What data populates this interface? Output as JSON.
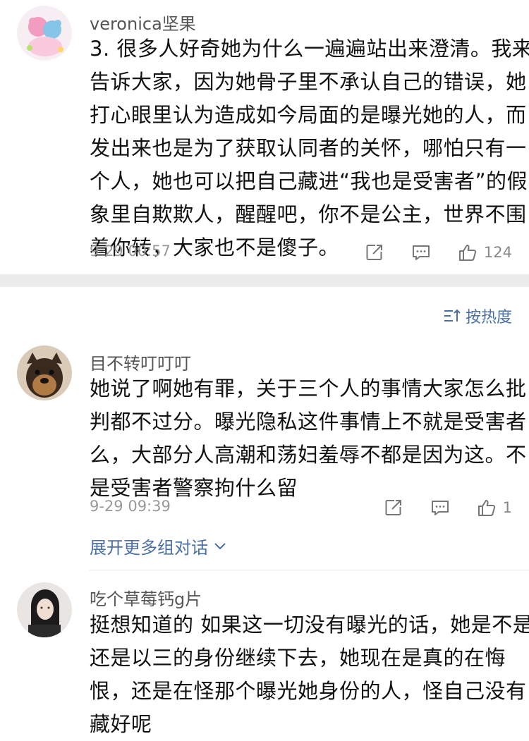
{
  "comments": [
    {
      "username": "veronica坚果",
      "lines": [
        "3. 很多人好奇她为什么一遍遍站出来澄清。我来",
        "告诉大家，因为她骨子里不承认自己的错误，她",
        "打心眼里认为造成如今局面的是曝光她的人，而",
        "发出来也是为了获取认同者的关怀，哪怕只有一",
        "个人，她也可以把自己藏进“我也是受害者”的假",
        "象里自欺欺人，醒醒吧，你不是公主，世界不围",
        "着你转，大家也不是傻子。"
      ],
      "time": "9-29 00:57",
      "likes": "124"
    },
    {
      "username": "目不转叮叮叮",
      "lines": [
        "她说了啊她有罪，关于三个人的事情大家怎么批",
        "判都不过分。曝光隐私这件事情上不就是受害者",
        "么，大部分人高潮和荡妇羞辱不都是因为这。不",
        "是受害者警察拘什么留"
      ],
      "time": "9-29 09:39",
      "likes": "1"
    },
    {
      "username": "吃个草莓钙g片",
      "lines": [
        "挺想知道的 如果这一切没有曝光的话，她是不是",
        "还是以三的身份继续下去，她现在是真的在悔",
        "恨，还是在怪那个曝光她身份的人，怪自己没有",
        "藏好呢"
      ]
    }
  ],
  "sort_label": "按热度",
  "expand_label": "展开更多组对话",
  "icons": {
    "repost": "share-icon",
    "comment": "comment-icon",
    "like": "thumbs-up-icon",
    "sort": "sort-icon",
    "expand": "chevron-down-icon"
  },
  "colors": {
    "link": "#4a6fa5",
    "band": "#ececec",
    "meta": "#999999"
  }
}
